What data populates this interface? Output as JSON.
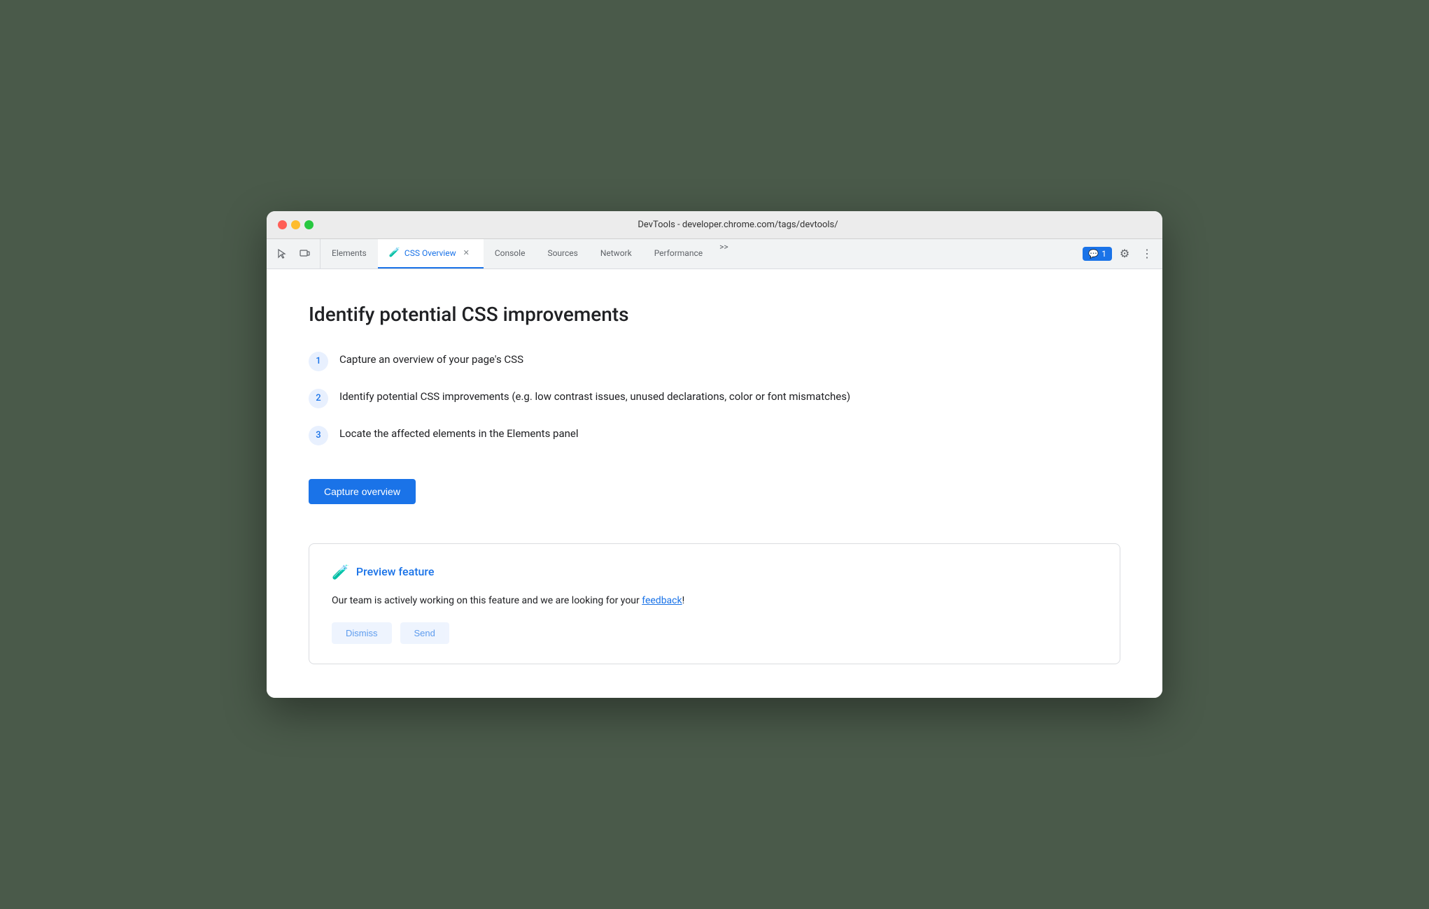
{
  "window": {
    "title": "DevTools - developer.chrome.com/tags/devtools/"
  },
  "traffic_lights": {
    "red": "red",
    "yellow": "yellow",
    "green": "green"
  },
  "toolbar": {
    "tabs": [
      {
        "label": "Elements",
        "active": false,
        "closable": false
      },
      {
        "label": "CSS Overview",
        "active": true,
        "closable": true
      },
      {
        "label": "Console",
        "active": false,
        "closable": false
      },
      {
        "label": "Sources",
        "active": false,
        "closable": false
      },
      {
        "label": "Network",
        "active": false,
        "closable": false
      },
      {
        "label": "Performance",
        "active": false,
        "closable": false
      }
    ],
    "more_tabs_label": ">>",
    "chat_badge_label": "1",
    "settings_icon": "⚙",
    "more_icon": "⋮",
    "cursor_icon": "⬚",
    "device_icon": "☰"
  },
  "content": {
    "page_title": "Identify potential CSS improvements",
    "steps": [
      {
        "number": "1",
        "text": "Capture an overview of your page's CSS"
      },
      {
        "number": "2",
        "text": "Identify potential CSS improvements (e.g. low contrast issues, unused declarations, color or font mismatches)"
      },
      {
        "number": "3",
        "text": "Locate the affected elements in the Elements panel"
      }
    ],
    "capture_button_label": "Capture overview",
    "preview_card": {
      "icon": "🧪",
      "title": "Preview feature",
      "text_before": "Our team is actively working on this feature and we are looking for your ",
      "feedback_link": "feedback",
      "text_after": "!"
    }
  },
  "colors": {
    "blue_accent": "#1a73e8",
    "step_bg": "#e8f0fe",
    "text_primary": "#202124",
    "text_secondary": "#5f6368"
  }
}
